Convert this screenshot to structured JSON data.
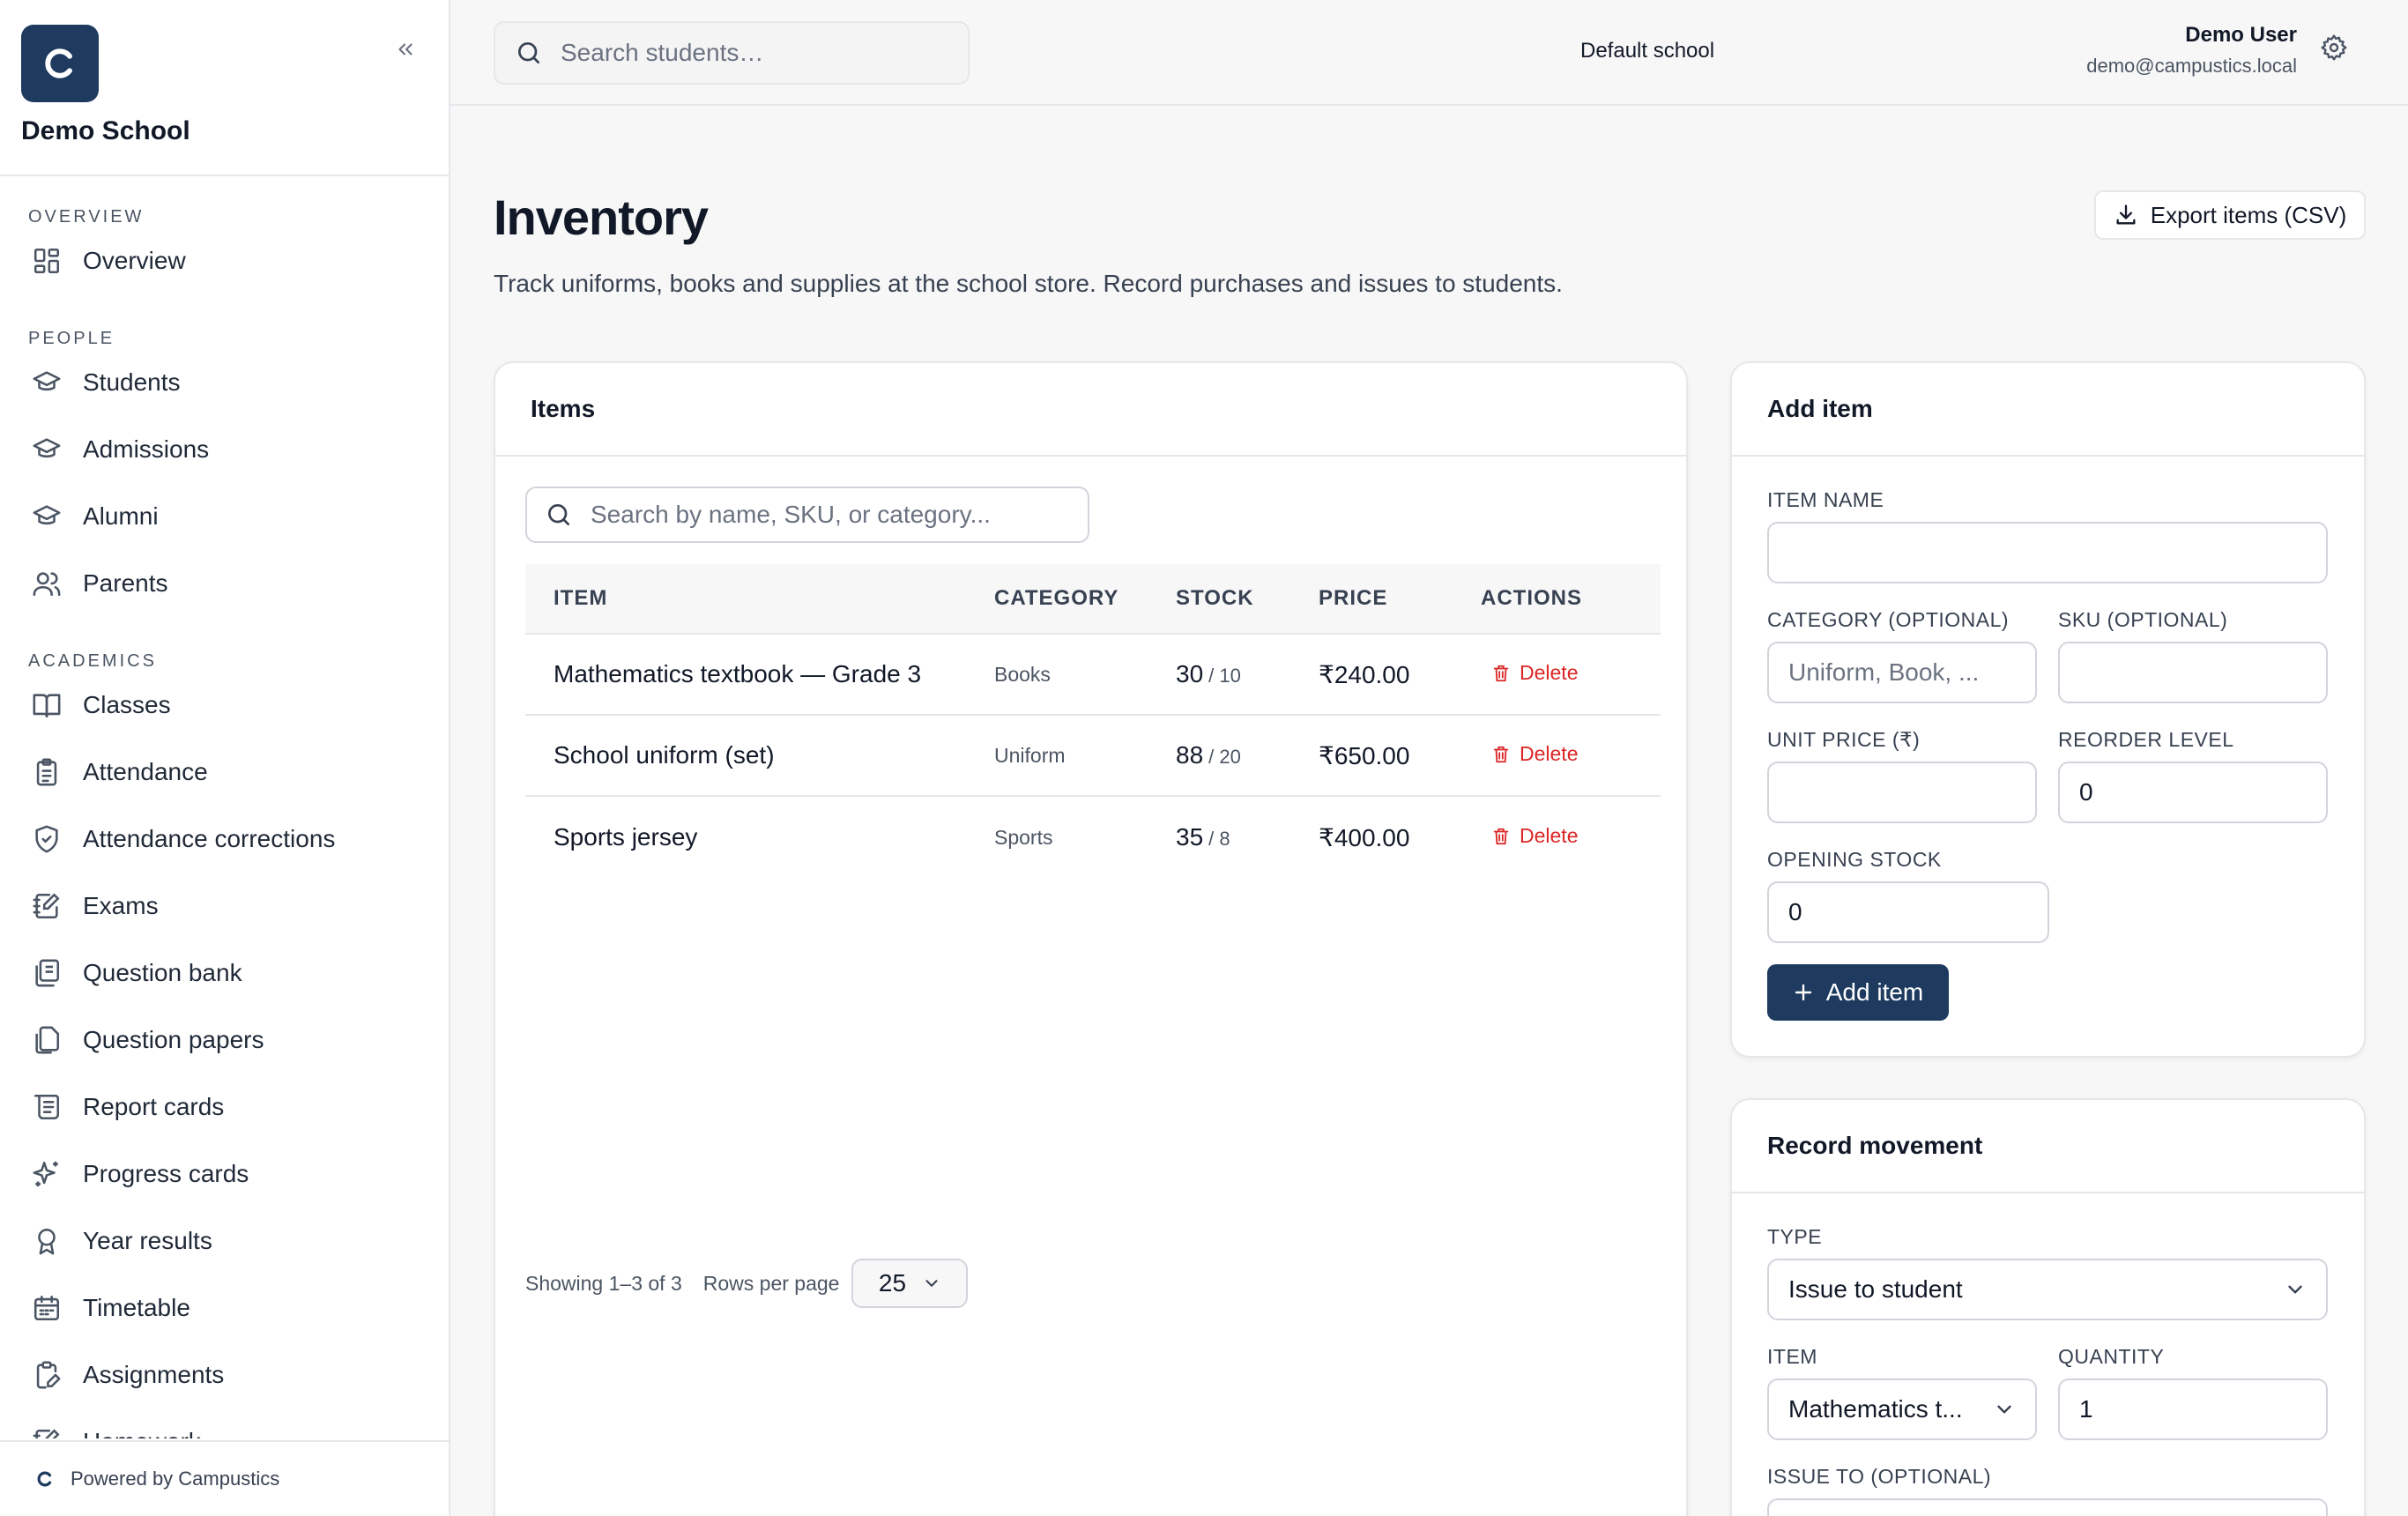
{
  "brand": {
    "school_name": "Demo School",
    "logo_letter": "C"
  },
  "sidebar": {
    "sections": [
      {
        "title": "OVERVIEW",
        "items": [
          {
            "label": "Overview",
            "icon": "grid-icon"
          }
        ]
      },
      {
        "title": "PEOPLE",
        "items": [
          {
            "label": "Students",
            "icon": "graduation-cap-icon"
          },
          {
            "label": "Admissions",
            "icon": "graduation-cap-icon"
          },
          {
            "label": "Alumni",
            "icon": "graduation-cap-icon"
          },
          {
            "label": "Parents",
            "icon": "users-icon"
          }
        ]
      },
      {
        "title": "ACADEMICS",
        "items": [
          {
            "label": "Classes",
            "icon": "book-open-icon"
          },
          {
            "label": "Attendance",
            "icon": "clipboard-icon"
          },
          {
            "label": "Attendance corrections",
            "icon": "shield-check-icon"
          },
          {
            "label": "Exams",
            "icon": "notebook-pen-icon"
          },
          {
            "label": "Question bank",
            "icon": "library-icon"
          },
          {
            "label": "Question papers",
            "icon": "files-icon"
          },
          {
            "label": "Report cards",
            "icon": "scroll-icon"
          },
          {
            "label": "Progress cards",
            "icon": "sparkles-icon"
          },
          {
            "label": "Year results",
            "icon": "award-icon"
          },
          {
            "label": "Timetable",
            "icon": "calendar-icon"
          },
          {
            "label": "Assignments",
            "icon": "clipboard-pen-icon"
          },
          {
            "label": "Homework",
            "icon": "notebook-pen-icon"
          }
        ]
      }
    ],
    "footer": "Powered by Campustics"
  },
  "topbar": {
    "search_placeholder": "Search students…",
    "school_selector": "Default school",
    "user_name": "Demo User",
    "user_email": "demo@campustics.local"
  },
  "page": {
    "title": "Inventory",
    "subtitle": "Track uniforms, books and supplies at the school store. Record purchases and issues to students.",
    "export_label": "Export items (CSV)"
  },
  "items": {
    "card_title": "Items",
    "search_placeholder": "Search by name, SKU, or category...",
    "columns": [
      "ITEM",
      "CATEGORY",
      "STOCK",
      "PRICE",
      "ACTIONS"
    ],
    "rows": [
      {
        "name": "Mathematics textbook — Grade 3",
        "category": "Books",
        "stock": "30",
        "reorder": "/ 10",
        "price": "₹240.00",
        "action": "Delete"
      },
      {
        "name": "School uniform (set)",
        "category": "Uniform",
        "stock": "88",
        "reorder": "/ 20",
        "price": "₹650.00",
        "action": "Delete"
      },
      {
        "name": "Sports jersey",
        "category": "Sports",
        "stock": "35",
        "reorder": "/ 8",
        "price": "₹400.00",
        "action": "Delete"
      }
    ],
    "showing": "Showing 1–3 of 3",
    "rows_per_page_label": "Rows per page",
    "rows_per_page_value": "25"
  },
  "add_item": {
    "title": "Add item",
    "item_name_label": "ITEM NAME",
    "item_name_value": "",
    "category_label": "CATEGORY (OPTIONAL)",
    "category_placeholder": "Uniform, Book, ...",
    "sku_label": "SKU (OPTIONAL)",
    "sku_value": "",
    "unit_price_label": "UNIT PRICE (₹)",
    "unit_price_value": "",
    "reorder_label": "REORDER LEVEL",
    "reorder_value": "0",
    "opening_stock_label": "OPENING STOCK",
    "opening_stock_value": "0",
    "submit_label": "Add item"
  },
  "movement": {
    "title": "Record movement",
    "type_label": "TYPE",
    "type_value": "Issue to student",
    "item_label": "ITEM",
    "item_value": "Mathematics t...",
    "quantity_label": "QUANTITY",
    "quantity_value": "1",
    "issue_to_label": "ISSUE TO (OPTIONAL)"
  },
  "colors": {
    "brand": "#1e3a5f",
    "danger": "#dc2626",
    "border": "#e5e7eb",
    "background": "#f7f7f7"
  }
}
